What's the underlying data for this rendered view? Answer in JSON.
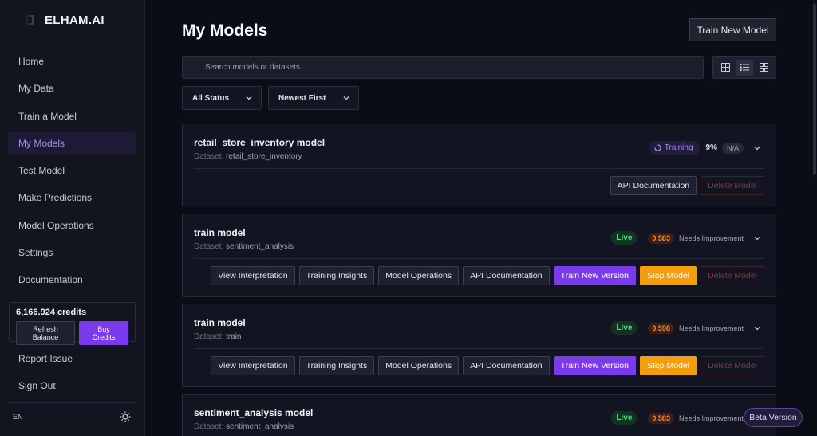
{
  "brand": {
    "name": "ELHAM.AI",
    "logo_icon": "brand-logo-icon"
  },
  "nav": [
    {
      "label": "Home"
    },
    {
      "label": "My Data"
    },
    {
      "label": "Train a Model"
    },
    {
      "label": "My Models",
      "active": true
    },
    {
      "label": "Test Model"
    },
    {
      "label": "Make Predictions"
    },
    {
      "label": "Model Operations"
    },
    {
      "label": "Settings"
    },
    {
      "label": "Documentation"
    }
  ],
  "credits": {
    "amount": "6,166.924 credits",
    "refresh_label": "Refresh Balance",
    "buy_label": "Buy Credits"
  },
  "nav_bottom": [
    {
      "label": "Report Issue"
    },
    {
      "label": "Sign Out"
    }
  ],
  "footer": {
    "lang": "EN",
    "theme_icon": "sun-icon"
  },
  "page": {
    "title": "My Models",
    "train_new_label": "Train New Model"
  },
  "search": {
    "placeholder": "Search models or datasets..."
  },
  "filters": {
    "status": "All Status",
    "sort": "Newest First"
  },
  "view_modes": [
    "table-view-icon",
    "list-view-icon",
    "grid-view-icon"
  ],
  "dataset_label": "Dataset:",
  "models": [
    {
      "name": "retail_store_inventory model",
      "dataset": "retail_store_inventory",
      "status": "Training",
      "progress": "9%",
      "score": "N/A",
      "actions": [
        "API Documentation",
        "Delete Model"
      ]
    },
    {
      "name": "train model",
      "dataset": "sentiment_analysis",
      "status": "Live",
      "score": "0.583",
      "assessment": "Needs Improvement",
      "actions": [
        "View Interpretation",
        "Training Insights",
        "Model Operations",
        "API Documentation",
        "Train New Version",
        "Stop Model",
        "Delete Model"
      ]
    },
    {
      "name": "train model",
      "dataset": "train",
      "status": "Live",
      "score": "0.598",
      "assessment": "Needs Improvement",
      "actions": [
        "View Interpretation",
        "Training Insights",
        "Model Operations",
        "API Documentation",
        "Train New Version",
        "Stop Model",
        "Delete Model"
      ]
    },
    {
      "name": "sentiment_analysis model",
      "dataset": "sentiment_analysis",
      "status": "Live",
      "score": "0.583",
      "assessment": "Needs Improvement"
    }
  ],
  "beta_label": "Beta Version",
  "colors": {
    "accent": "#7c3aed",
    "live": "#4ade80",
    "warning": "#f59e0b",
    "score": "#fb923c",
    "background": "#0b0d16"
  }
}
